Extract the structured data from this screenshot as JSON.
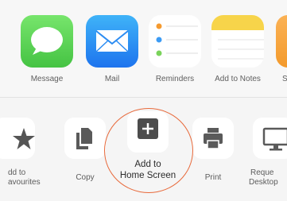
{
  "share_sheet": {
    "apps": [
      {
        "label": "Message",
        "icon": "message-icon"
      },
      {
        "label": "Mail",
        "icon": "mail-icon"
      },
      {
        "label": "Reminders",
        "icon": "reminders-icon"
      },
      {
        "label": "Add to Notes",
        "icon": "notes-icon"
      },
      {
        "label": "S",
        "icon": "app-icon"
      }
    ],
    "actions": [
      {
        "label_line1": "dd to",
        "label_line2": "avourites",
        "icon": "star-icon"
      },
      {
        "label": "Copy",
        "icon": "copy-icon"
      },
      {
        "label_line1": "Add to",
        "label_line2": "Home Screen",
        "icon": "plus-icon"
      },
      {
        "label": "Print",
        "icon": "printer-icon"
      },
      {
        "label_line1": "Reque",
        "label_line2": "Desktop",
        "icon": "desktop-icon"
      }
    ]
  },
  "colors": {
    "message_green": "#5fd35a",
    "mail_blue": "#2f8ef3",
    "notes_yellow": "#f7d44a",
    "highlight_orange": "#e8693a"
  }
}
